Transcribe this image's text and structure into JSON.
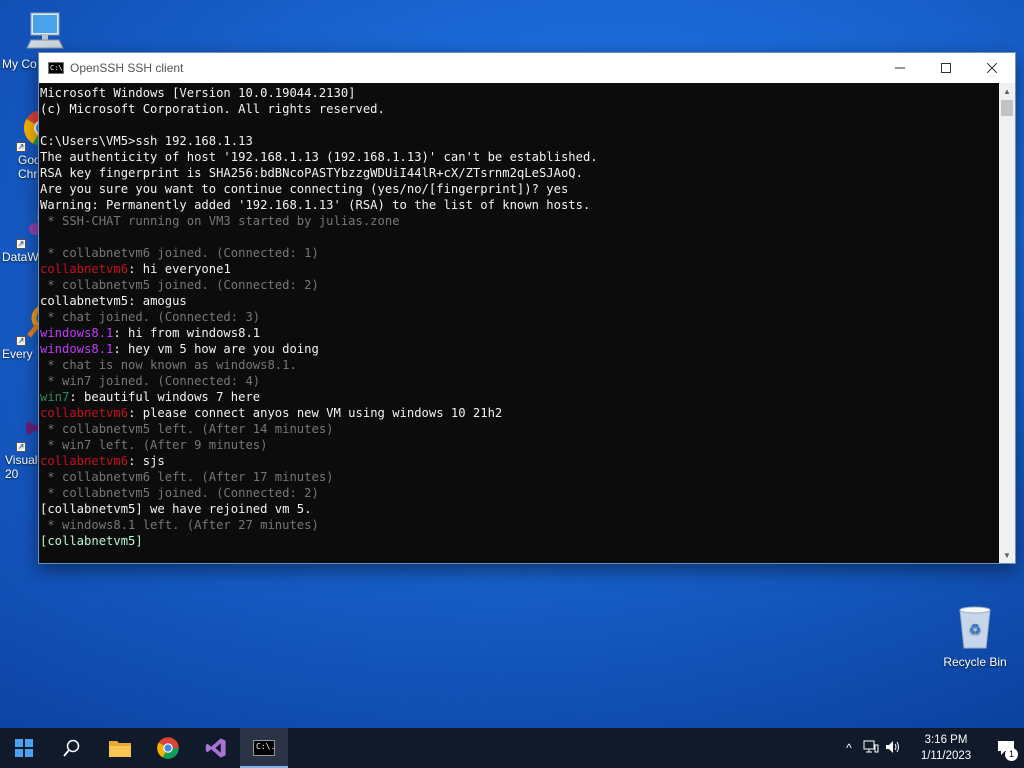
{
  "desktop": {
    "icons": [
      {
        "label": "My Co"
      },
      {
        "label": "Goo\nChr"
      },
      {
        "label": "DataW"
      },
      {
        "label": "Every"
      },
      {
        "label": "Visual\n20"
      }
    ],
    "recycle_bin": {
      "label": "Recycle Bin"
    }
  },
  "window": {
    "title": "OpenSSH SSH client",
    "icon_text": "C:\\."
  },
  "colors": {
    "default": "#cccccc",
    "system": "#767676",
    "white": "#f2f2f2",
    "red": "#c50f1f",
    "magenta": "#c239ff",
    "green": "#2a8a5a",
    "highlight": "#b5f5d0"
  },
  "console": {
    "lines": [
      [
        {
          "t": "Microsoft Windows [Version 10.0.19044.2130]",
          "c": "white"
        }
      ],
      [
        {
          "t": "(c) Microsoft Corporation. All rights reserved.",
          "c": "white"
        }
      ],
      [
        {
          "t": "",
          "c": "white"
        }
      ],
      [
        {
          "t": "C:\\Users\\VM5>ssh 192.168.1.13",
          "c": "white"
        }
      ],
      [
        {
          "t": "The authenticity of host '192.168.1.13 (192.168.1.13)' can't be established.",
          "c": "white"
        }
      ],
      [
        {
          "t": "RSA key fingerprint is SHA256:bdBNcoPASTYbzzgWDUiI44lR+cX/ZTsrnm2qLeSJAoQ.",
          "c": "white"
        }
      ],
      [
        {
          "t": "Are you sure you want to continue connecting (yes/no/[fingerprint])? yes",
          "c": "white"
        }
      ],
      [
        {
          "t": "Warning: Permanently added '192.168.1.13' (RSA) to the list of known hosts.",
          "c": "white"
        }
      ],
      [
        {
          "t": " * SSH-CHAT running on VM3 started by julias.zone",
          "c": "system"
        }
      ],
      [
        {
          "t": "",
          "c": "system"
        }
      ],
      [
        {
          "t": " * collabnetvm6 joined. (Connected: 1)",
          "c": "system"
        }
      ],
      [
        {
          "t": "collabnetvm6",
          "c": "red"
        },
        {
          "t": ": hi everyone1",
          "c": "white"
        }
      ],
      [
        {
          "t": " * collabnetvm5 joined. (Connected: 2)",
          "c": "system"
        }
      ],
      [
        {
          "t": "collabnetvm5",
          "c": "white"
        },
        {
          "t": ": amogus",
          "c": "white"
        }
      ],
      [
        {
          "t": " * chat joined. (Connected: 3)",
          "c": "system"
        }
      ],
      [
        {
          "t": "windows8.1",
          "c": "magenta"
        },
        {
          "t": ": hi from windows8.1",
          "c": "white"
        }
      ],
      [
        {
          "t": "windows8.1",
          "c": "magenta"
        },
        {
          "t": ": hey vm 5 how are you doing",
          "c": "white"
        }
      ],
      [
        {
          "t": " * chat is now known as windows8.1.",
          "c": "system"
        }
      ],
      [
        {
          "t": " * win7 joined. (Connected: 4)",
          "c": "system"
        }
      ],
      [
        {
          "t": "win7",
          "c": "green"
        },
        {
          "t": ": beautiful windows 7 here",
          "c": "white"
        }
      ],
      [
        {
          "t": "collabnetvm6",
          "c": "red"
        },
        {
          "t": ": please connect anyos new VM using windows 10 21h2",
          "c": "white"
        }
      ],
      [
        {
          "t": " * collabnetvm5 left. (After 14 minutes)",
          "c": "system"
        }
      ],
      [
        {
          "t": " * win7 left. (After 9 minutes)",
          "c": "system"
        }
      ],
      [
        {
          "t": "collabnetvm6",
          "c": "red"
        },
        {
          "t": ": sjs",
          "c": "white"
        }
      ],
      [
        {
          "t": " * collabnetvm6 left. (After 17 minutes)",
          "c": "system"
        }
      ],
      [
        {
          "t": " * collabnetvm5 joined. (Connected: 2)",
          "c": "system"
        }
      ],
      [
        {
          "t": "[collabnetvm5] we have rejoined vm 5.",
          "c": "white"
        }
      ],
      [
        {
          "t": " * windows8.1 left. (After 27 minutes)",
          "c": "system"
        }
      ],
      [
        {
          "t": "[collabnetvm5] ",
          "c": "highlight"
        }
      ]
    ]
  },
  "taskbar": {
    "clock_time": "3:16 PM",
    "clock_date": "1/11/2023",
    "notification_count": "1",
    "console_icon_text": "C:\\."
  }
}
